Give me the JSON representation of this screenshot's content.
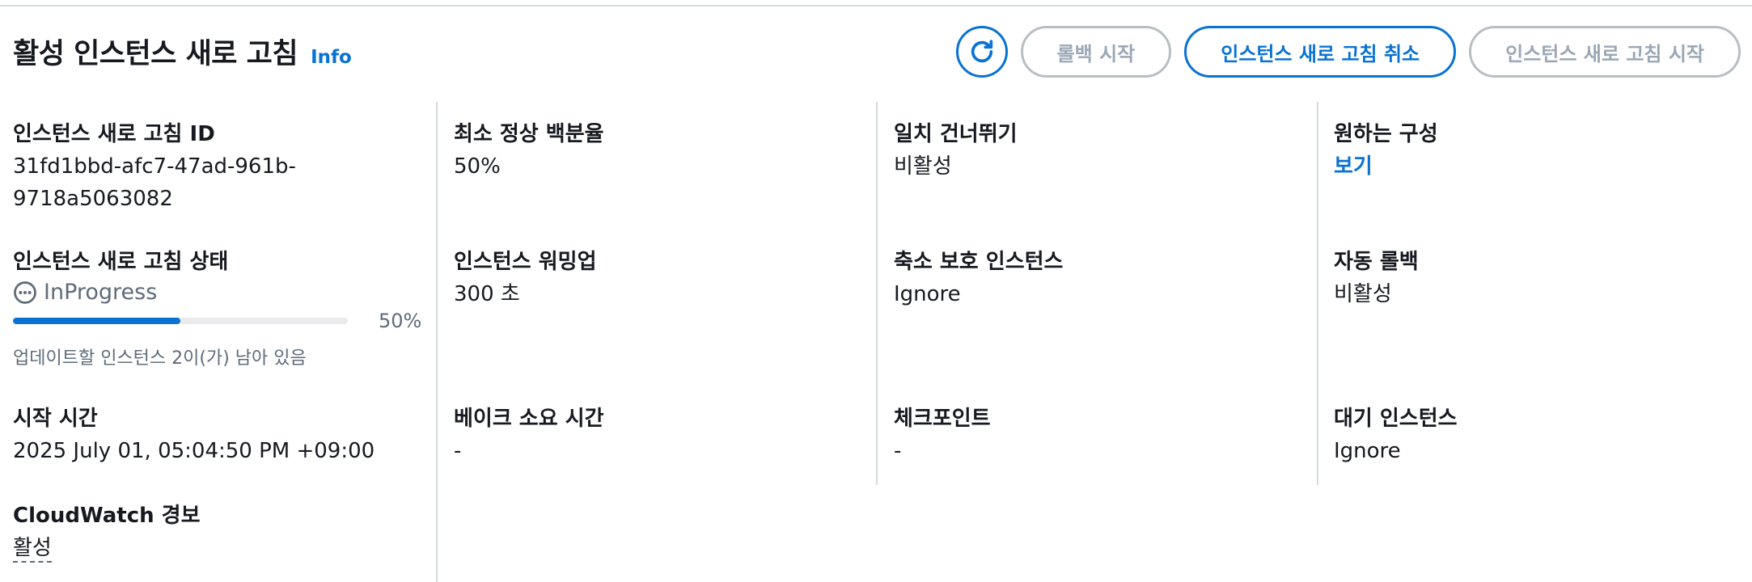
{
  "header": {
    "title": "활성 인스턴스 새로 고침",
    "info": "Info"
  },
  "actions": {
    "refresh_icon": "refresh-icon",
    "rollback": "롤백 시작",
    "cancel": "인스턴스 새로 고침 취소",
    "start": "인스턴스 새로 고침 시작"
  },
  "col1": {
    "refresh_id_label": "인스턴스 새로 고침 ID",
    "refresh_id_line1": "31fd1bbd-afc7-47ad-961b-",
    "refresh_id_line2": "9718a5063082",
    "status_label": "인스턴스 새로 고침 상태",
    "status_value": "InProgress",
    "progress_fraction": 0.5,
    "progress_text": "50%",
    "progress_desc": "업데이트할 인스턴스 2이(가) 남아 있음",
    "start_time_label": "시작 시간",
    "start_time_value": "2025 July 01, 05:04:50 PM +09:00",
    "alarm_label": "CloudWatch 경보",
    "alarm_value": "활성"
  },
  "col2": {
    "min_healthy_label": "최소 정상 백분율",
    "min_healthy_value": "50%",
    "warmup_label": "인스턴스 워밍업",
    "warmup_value": "300 초",
    "bake_label": "베이크 소요 시간",
    "bake_value": "-"
  },
  "col3": {
    "skip_match_label": "일치 건너뛰기",
    "skip_match_value": "비활성",
    "scalein_label": "축소 보호 인스턴스",
    "scalein_value": "Ignore",
    "checkpoint_label": "체크포인트",
    "checkpoint_value": "-"
  },
  "col4": {
    "desired_label": "원하는 구성",
    "desired_value": "보기",
    "auto_rollback_label": "자동 롤백",
    "auto_rollback_value": "비활성",
    "standby_label": "대기 인스턴스",
    "standby_value": "Ignore"
  },
  "colors": {
    "accent": "#0972d3",
    "disabled": "#9ba7b6",
    "muted": "#5f6b7a"
  }
}
